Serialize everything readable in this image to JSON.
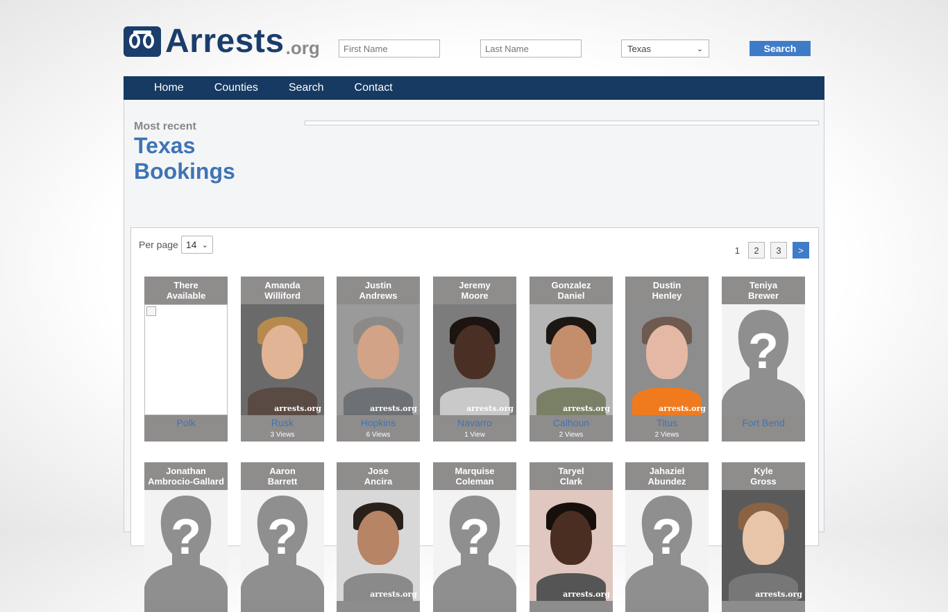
{
  "header": {
    "logo_text": "Arrests",
    "logo_suffix": ".org",
    "first_name_placeholder": "First Name",
    "last_name_placeholder": "Last Name",
    "state_selected": "Texas",
    "search_label": "Search"
  },
  "nav": {
    "items": [
      "Home",
      "Counties",
      "Search",
      "Contact"
    ]
  },
  "intro": {
    "subtitle": "Most recent",
    "title_line1": "Texas",
    "title_line2": "Bookings"
  },
  "listing": {
    "per_page_label": "Per page",
    "per_page_value": "14",
    "pagination": {
      "current": "1",
      "pages": [
        "2",
        "3"
      ],
      "next": ">"
    }
  },
  "cards": [
    {
      "first": "There",
      "last": "Available",
      "county": "Polk",
      "views": "",
      "photo": "broken"
    },
    {
      "first": "Amanda",
      "last": "Williford",
      "county": "Rusk",
      "views": "3 Views",
      "photo": "mugshot"
    },
    {
      "first": "Justin",
      "last": "Andrews",
      "county": "Hopkins",
      "views": "6 Views",
      "photo": "mugshot"
    },
    {
      "first": "Jeremy",
      "last": "Moore",
      "county": "Navarro",
      "views": "1 View",
      "photo": "mugshot"
    },
    {
      "first": "Gonzalez",
      "last": "Daniel",
      "county": "Calhoun",
      "views": "2 Views",
      "photo": "mugshot"
    },
    {
      "first": "Dustin",
      "last": "Henley",
      "county": "Titus",
      "views": "2 Views",
      "photo": "mugshot"
    },
    {
      "first": "Teniya",
      "last": "Brewer",
      "county": "Fort Bend",
      "views": "",
      "photo": "unknown"
    },
    {
      "first": "Jonathan",
      "last": "Ambrocio-Gallard",
      "county": "",
      "views": "",
      "photo": "unknown"
    },
    {
      "first": "Aaron",
      "last": "Barrett",
      "county": "",
      "views": "",
      "photo": "unknown"
    },
    {
      "first": "Jose",
      "last": "Ancira",
      "county": "",
      "views": "",
      "photo": "mugshot"
    },
    {
      "first": "Marquise",
      "last": "Coleman",
      "county": "",
      "views": "",
      "photo": "unknown"
    },
    {
      "first": "Taryel",
      "last": "Clark",
      "county": "",
      "views": "",
      "photo": "mugshot"
    },
    {
      "first": "Jahaziel",
      "last": "Abundez",
      "county": "",
      "views": "",
      "photo": "unknown"
    },
    {
      "first": "Kyle",
      "last": "Gross",
      "county": "",
      "views": "",
      "photo": "mugshot"
    }
  ],
  "watermark": "arrests.org",
  "colors": {
    "brand_navy": "#163a61",
    "accent_blue": "#3f7cc8",
    "link_blue": "#3d74b5",
    "card_gray": "#8f8c8c"
  }
}
